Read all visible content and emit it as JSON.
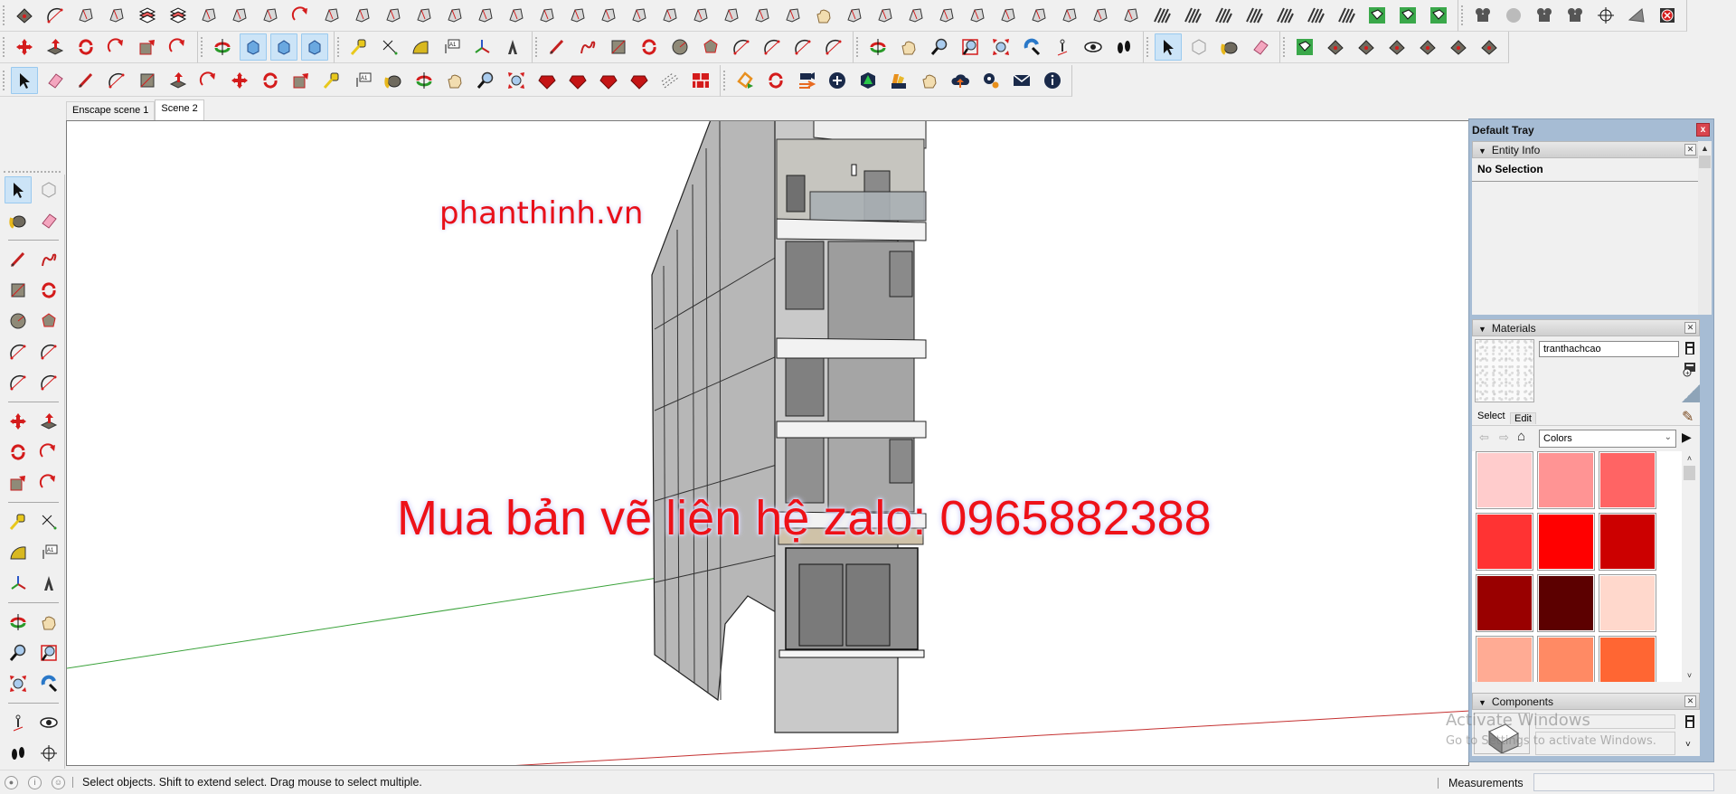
{
  "toolbar": {
    "row1_icons": [
      "sandbox-from-scratch-icon",
      "arc-point-icon",
      "bezier-curve-icon",
      "push-tool-icon",
      "layers-icon",
      "layers-color-icon",
      "intersect-icon",
      "smooth-edges-icon",
      "extrude-edges-icon",
      "follow-me-icon",
      "bend-icon",
      "shape-bender-icon",
      "cut-opening-icon",
      "round-corner-icon",
      "joint-push-icon",
      "fillet-icon",
      "chamfer-icon",
      "angle-icon",
      "tube-icon",
      "window-maker-icon",
      "profile-builder-icon",
      "flatten-icon",
      "column-icon",
      "balusters-icon",
      "hand-rail-icon",
      "curved-wall-icon",
      "wall-panel-icon",
      "wall-tool-icon",
      "stairs-icon",
      "bolt-icon",
      "foundation-icon",
      "cross-brace-icon",
      "stair-maker-icon",
      "slope-icon",
      "door-frame-icon",
      "door-icon",
      "grid-window-icon",
      "hatch-1-icon",
      "hatch-2-icon",
      "hatch-3-icon",
      "hatch-4-icon",
      "hatch-5-icon",
      "hatch-6-icon",
      "hatch-7-icon",
      "terrain-icon",
      "terrain-stamp-icon",
      "contour-icon",
      "render-camera-icon",
      "render-sphere-icon",
      "render-camera-2-icon",
      "render-camera-3-icon",
      "section-plane-icon",
      "section-fill-icon",
      "cancel-render-icon"
    ],
    "row2_icons": [
      "move-icon",
      "push-pull-icon",
      "rotate-icon",
      "follow-me-icon",
      "scale-icon",
      "offset-icon",
      "orbit-center-icon",
      "view-iso-icon",
      "view-top-icon",
      "view-front-icon",
      "tape-measure-icon",
      "dimension-icon",
      "protractor-icon",
      "text-icon",
      "axes-icon",
      "3d-text-icon",
      "pencil-icon",
      "freehand-icon",
      "rectangle-icon",
      "rotated-rectangle-icon",
      "circle-icon",
      "polygon-icon",
      "arc-icon",
      "2pt-arc-icon",
      "3pt-arc-icon",
      "pie-icon",
      "orbit-icon",
      "pan-icon",
      "zoom-icon",
      "zoom-window-icon",
      "zoom-extents-icon",
      "previous-view-icon",
      "position-camera-icon",
      "look-around-icon",
      "walk-icon",
      "select-icon",
      "make-component-icon",
      "paint-bucket-icon",
      "eraser-icon",
      "sandbox-contours-icon",
      "sandbox-scratch-icon",
      "smoove-icon",
      "stamp-icon",
      "drape-icon",
      "add-detail-icon",
      "flip-edge-icon"
    ],
    "row3_icons": [
      "select-icon",
      "eraser-icon",
      "pencil-icon",
      "arc-icon",
      "rectangle-icon",
      "push-pull-icon",
      "offset-icon",
      "move-icon",
      "rotate-icon",
      "scale-icon",
      "tape-measure-icon",
      "text-icon",
      "paint-bucket-icon",
      "orbit-icon",
      "pan-icon",
      "zoom-icon",
      "zoom-extents-icon",
      "ruby-console-icon",
      "extension-manager-icon",
      "extension-warehouse-icon",
      "ruby-gem-icon",
      "dashed-lines-icon",
      "brick-wall-icon",
      "enscape-start-icon",
      "enscape-sync-icon",
      "enscape-video-icon",
      "enscape-add-icon",
      "enscape-asset-icon",
      "enscape-materials-icon",
      "enscape-panorama-icon",
      "enscape-upload-icon",
      "enscape-settings-icon",
      "enscape-feedback-icon",
      "enscape-about-icon"
    ]
  },
  "scene_tabs": [
    {
      "label": "Enscape scene 1",
      "active": false
    },
    {
      "label": "Scene 2",
      "active": true
    }
  ],
  "left_toolbar": {
    "groups": [
      [
        [
          "select-icon",
          "make-component-icon"
        ],
        [
          "paint-bucket-icon",
          "eraser-icon"
        ]
      ],
      [
        [
          "pencil-icon",
          "freehand-icon"
        ],
        [
          "rectangle-icon",
          "rotated-rectangle-icon"
        ],
        [
          "circle-icon",
          "polygon-icon"
        ],
        [
          "arc-icon",
          "2pt-arc-icon"
        ],
        [
          "3pt-arc-icon",
          "pie-icon"
        ]
      ],
      [
        [
          "move-icon",
          "push-pull-icon"
        ],
        [
          "rotate-icon",
          "follow-me-icon"
        ],
        [
          "scale-icon",
          "offset-icon"
        ]
      ],
      [
        [
          "tape-measure-icon",
          "dimension-icon"
        ],
        [
          "protractor-icon",
          "text-icon"
        ],
        [
          "axes-icon",
          "3d-text-icon"
        ]
      ],
      [
        [
          "orbit-icon",
          "pan-icon"
        ],
        [
          "zoom-icon",
          "zoom-window-icon"
        ],
        [
          "zoom-extents-icon",
          "previous-view-icon"
        ]
      ],
      [
        [
          "position-camera-icon",
          "look-around-icon"
        ],
        [
          "walk-icon",
          "section-plane-icon"
        ]
      ]
    ]
  },
  "viewport": {
    "watermark_site": "phanthinh.vn",
    "watermark_contact": "Mua bản vẽ liên hệ zalo: 0965882388",
    "activate_title": "Activate Windows",
    "activate_sub": "Go to Settings to activate Windows."
  },
  "tray": {
    "title": "Default Tray",
    "close_label": "x",
    "entity_info": {
      "title": "Entity Info",
      "selection": "No Selection"
    },
    "materials": {
      "title": "Materials",
      "name_value": "tranthachcao",
      "tabs": [
        {
          "label": "Select",
          "active": true
        },
        {
          "label": "Edit",
          "active": false
        }
      ],
      "library": "Colors",
      "swatches": [
        "#ffcccc",
        "#ff9494",
        "#ff6464",
        "#ff3333",
        "#ff0000",
        "#cc0000",
        "#990000",
        "#5c0000",
        "#ffd8cc",
        "#ffab94",
        "#ff8a64",
        "#ff6633"
      ]
    },
    "components": {
      "title": "Components"
    }
  },
  "statusbar": {
    "hint": "Select objects. Shift to extend select. Drag mouse to select multiple.",
    "measurements_label": "Measurements",
    "measurements_value": ""
  }
}
